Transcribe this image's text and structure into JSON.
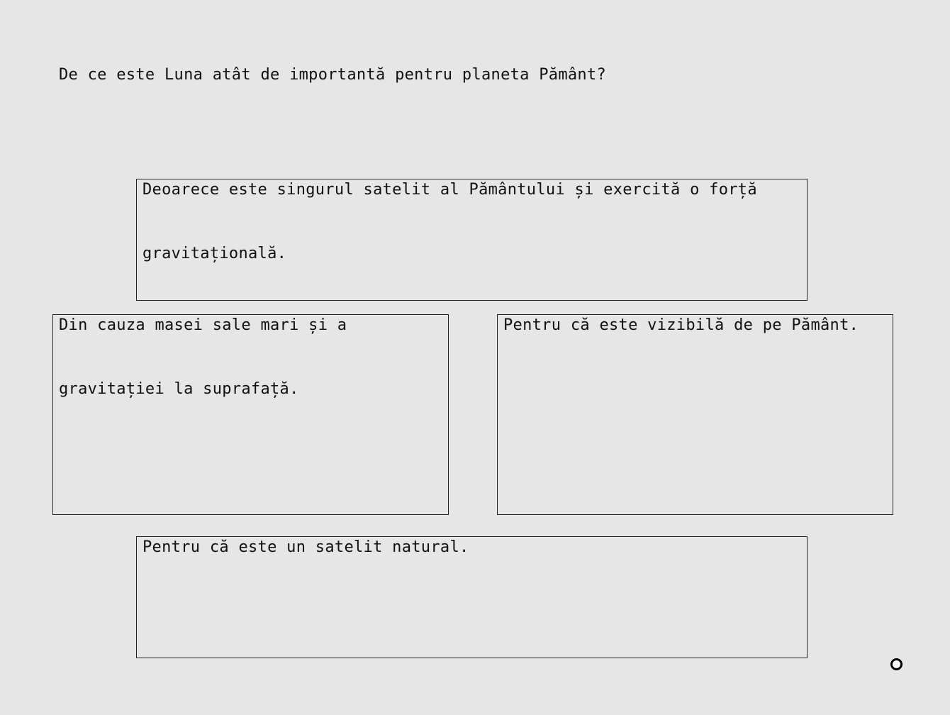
{
  "question": "De ce este Luna atât de importantă pentru planeta Pământ?",
  "answers": [
    "Deoarece este singurul satelit al Pământului și exercită o forță gravitațională.",
    "Din cauza masei sale mari și a gravitației la suprafață.",
    "Pentru că este vizibilă de pe Pământ.",
    "Pentru că este un satelit natural."
  ],
  "icons": {
    "cursor": "ring-cursor-icon"
  },
  "colors": {
    "background": "#e6e6e6",
    "border": "#222222",
    "text": "#111111"
  }
}
